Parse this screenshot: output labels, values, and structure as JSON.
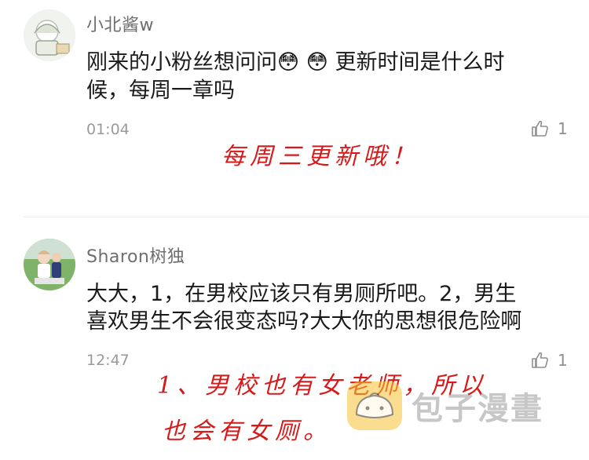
{
  "comments": [
    {
      "username": "小北酱w",
      "text_line1": "刚来的小粉丝想问问",
      "text_line1b": "更新时间是什么时",
      "text_line2": "候，每周一章吗",
      "emoji": "😳",
      "time": "01:04",
      "likes": "1",
      "handwritten_reply": "每周三更新哦！"
    },
    {
      "username": "Sharon树独",
      "text_line1": "大大，1，在男校应该只有男厕所吧。2，男生",
      "text_line2": "喜欢男生不会很变态吗?大大你的思想很危险啊",
      "time": "12:47",
      "likes": "1",
      "handwritten_reply_line1": "1、男校也有女老师，所以",
      "handwritten_reply_line2": "也会有女厕。"
    }
  ],
  "watermark": {
    "text": "包子漫畫",
    "icon": "bun-icon"
  },
  "icons": {
    "like": "thumbs-up-icon"
  }
}
